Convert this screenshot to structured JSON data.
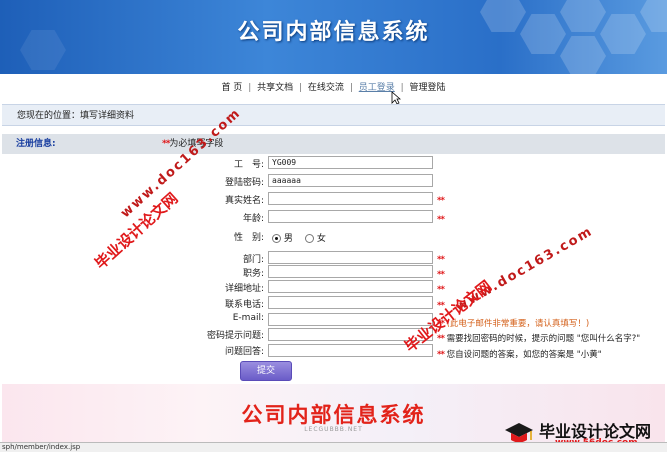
{
  "header": {
    "title": "公司内部信息系统"
  },
  "nav": {
    "items": [
      "首 页",
      "共享文档",
      "在线交流",
      "员工登录",
      "管理登陆"
    ],
    "separator": "|"
  },
  "location": {
    "text": "您现在的位置：填写详细资料"
  },
  "register": {
    "label": "注册信息:",
    "required_mark": "**",
    "required_text": "为必填写字段"
  },
  "form": {
    "employee_no": {
      "label": "工　号:",
      "value": "YG009"
    },
    "password": {
      "label": "登陆密码:",
      "value": "aaaaaa"
    },
    "real_name": {
      "label": "真实姓名:",
      "note": "**"
    },
    "age": {
      "label": "年龄:",
      "note": "**"
    },
    "gender": {
      "label": "性　别:",
      "male": "男",
      "female": "女",
      "selected": "男"
    },
    "department": {
      "label": "部门:",
      "note": "**"
    },
    "position": {
      "label": "职务:",
      "note": "**"
    },
    "address": {
      "label": "详细地址:",
      "note": "**"
    },
    "phone": {
      "label": "联系电话:",
      "note": "**"
    },
    "email": {
      "label": "E-mail:",
      "note_mark": "**",
      "note": "(此电子邮件非常重要，请认真填写！)"
    },
    "question": {
      "label": "密码提示问题:",
      "note_mark": "**",
      "note": "需要找回密码的时候，提示的问题 \"您叫什么名字?\""
    },
    "answer": {
      "label": "问题回答:",
      "note_mark": "**",
      "note": "您自设问题的答案，如您的答案是 \"小黄\""
    },
    "submit_label": "提交"
  },
  "footer": {
    "title": "公司内部信息系统",
    "subtitle": "LECGUBBB.NET"
  },
  "watermarks": {
    "site": "www.doc163.com",
    "cn": "毕业设计论文网",
    "corner_cn": "毕业设计论文网",
    "corner_url": "www.56doc.com"
  },
  "status_bar": {
    "url": "sph/member/index.jsp"
  },
  "colors": {
    "banner": "#2a6fc8",
    "accent_red": "#e0191b",
    "button": "#6a5cc8"
  }
}
